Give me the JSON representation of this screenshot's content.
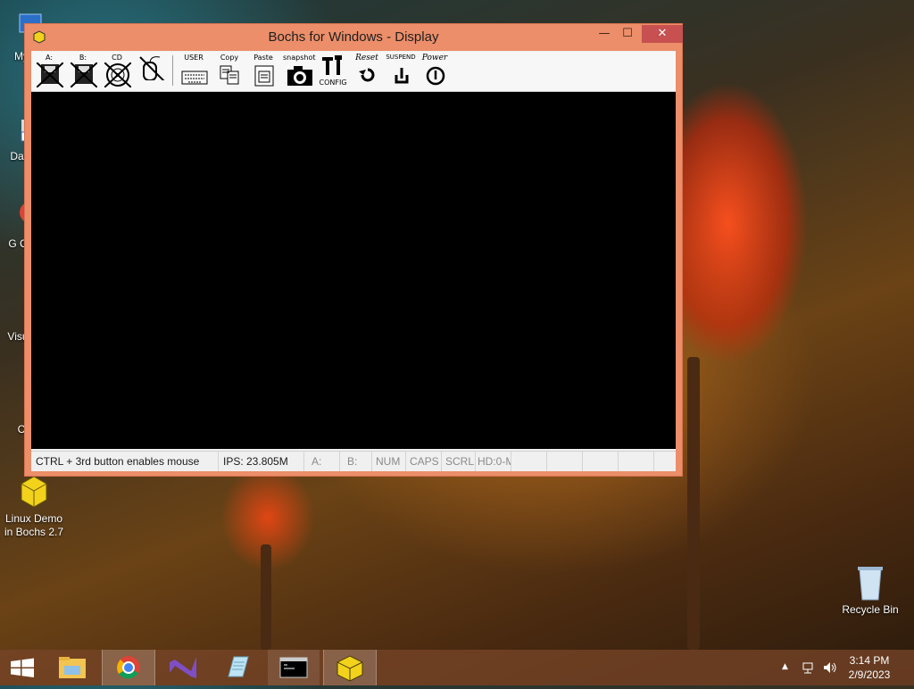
{
  "desktop": {
    "icons": [
      {
        "label": "My C"
      },
      {
        "label": "Data"
      },
      {
        "label": "G C"
      },
      {
        "label": "Visu"
      },
      {
        "label": "C"
      },
      {
        "label": "Linux Demo in Bochs 2.7"
      },
      {
        "label": "Recycle Bin"
      }
    ]
  },
  "window": {
    "title": "Bochs for Windows - Display",
    "controls": {
      "minimize": "—",
      "maximize": "☐",
      "close": "✕"
    },
    "toolbar": {
      "buttons": [
        {
          "label": "A:",
          "icon": "floppy-a-icon"
        },
        {
          "label": "B:",
          "icon": "floppy-b-icon"
        },
        {
          "label": "CD",
          "icon": "cdrom-icon"
        },
        {
          "label": "",
          "icon": "mouse-icon"
        },
        {
          "label": "USER",
          "icon": "keyboard-icon"
        },
        {
          "label": "Copy",
          "icon": "copy-icon"
        },
        {
          "label": "Paste",
          "icon": "paste-icon"
        },
        {
          "label": "snapshot",
          "icon": "camera-icon"
        },
        {
          "label": "CONFIG",
          "icon": "config-icon"
        },
        {
          "label": "Reset",
          "icon": "reset-icon"
        },
        {
          "label": "SUSPEND",
          "icon": "suspend-icon"
        },
        {
          "label": "Power",
          "icon": "power-icon"
        }
      ]
    },
    "statusbar": {
      "mouse_hint": "CTRL + 3rd button enables mouse",
      "ips": "IPS: 23.805M",
      "a": "A:",
      "b": "B:",
      "num": "NUM",
      "caps": "CAPS",
      "scrl": "SCRL",
      "hd": "HD:0-M"
    }
  },
  "taskbar": {
    "clock_time": "3:14 PM",
    "clock_date": "2/9/2023",
    "apps": [
      "start",
      "file-explorer",
      "chrome",
      "visual-studio",
      "notepad",
      "command-prompt",
      "bochs"
    ],
    "tray_up": "▲"
  }
}
